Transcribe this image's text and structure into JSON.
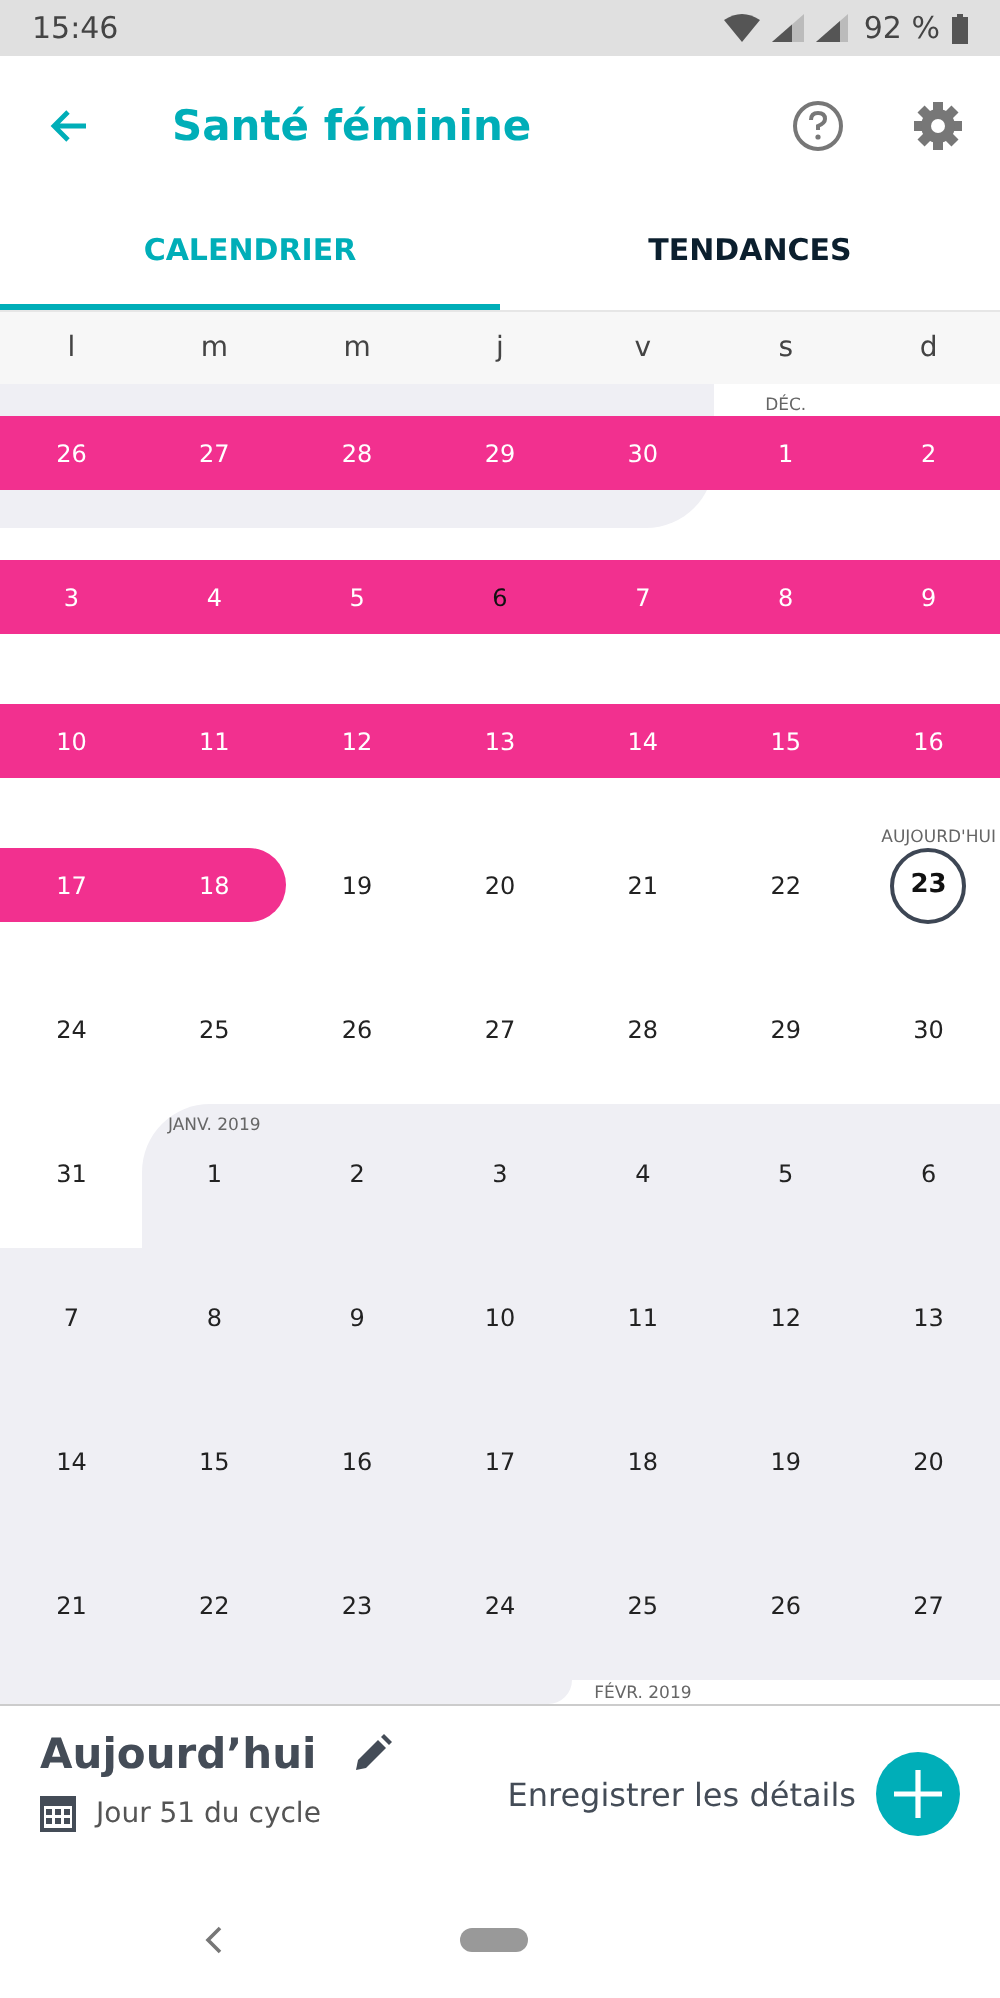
{
  "status_bar": {
    "time": "15:46",
    "battery": "92 %"
  },
  "app_bar": {
    "title": "Santé féminine"
  },
  "tabs": [
    {
      "label": "CALENDRIER",
      "selected": true
    },
    {
      "label": "TENDANCES",
      "selected": false
    }
  ],
  "weekdays": [
    "l",
    "m",
    "m",
    "j",
    "v",
    "s",
    "d"
  ],
  "weeks": [
    {
      "days": [
        {
          "number": "26",
          "period": true,
          "shaded": true,
          "selected": false,
          "today": false
        },
        {
          "number": "27",
          "period": true,
          "shaded": true,
          "selected": false,
          "today": false
        },
        {
          "number": "28",
          "period": true,
          "shaded": true,
          "selected": false,
          "today": false
        },
        {
          "number": "29",
          "period": true,
          "shaded": true,
          "selected": false,
          "today": false
        },
        {
          "number": "30",
          "period": true,
          "shaded": true,
          "selected": false,
          "today": false
        },
        {
          "number": "1",
          "period": true,
          "shaded": false,
          "selected": false,
          "today": false,
          "label": "DÉC."
        },
        {
          "number": "2",
          "period": true,
          "shaded": false,
          "selected": false,
          "today": false
        }
      ]
    },
    {
      "days": [
        {
          "number": "3",
          "period": true,
          "shaded": false,
          "selected": false,
          "today": false
        },
        {
          "number": "4",
          "period": true,
          "shaded": false,
          "selected": false,
          "today": false
        },
        {
          "number": "5",
          "period": true,
          "shaded": false,
          "selected": false,
          "today": false
        },
        {
          "number": "6",
          "period": true,
          "shaded": false,
          "selected": true,
          "today": false
        },
        {
          "number": "7",
          "period": true,
          "shaded": false,
          "selected": false,
          "today": false
        },
        {
          "number": "8",
          "period": true,
          "shaded": false,
          "selected": false,
          "today": false
        },
        {
          "number": "9",
          "period": true,
          "shaded": false,
          "selected": false,
          "today": false
        }
      ]
    },
    {
      "days": [
        {
          "number": "10",
          "period": true,
          "shaded": false,
          "selected": false,
          "today": false
        },
        {
          "number": "11",
          "period": true,
          "shaded": false,
          "selected": false,
          "today": false
        },
        {
          "number": "12",
          "period": true,
          "shaded": false,
          "selected": false,
          "today": false
        },
        {
          "number": "13",
          "period": true,
          "shaded": false,
          "selected": false,
          "today": false
        },
        {
          "number": "14",
          "period": true,
          "shaded": false,
          "selected": false,
          "today": false
        },
        {
          "number": "15",
          "period": true,
          "shaded": false,
          "selected": false,
          "today": false
        },
        {
          "number": "16",
          "period": true,
          "shaded": false,
          "selected": false,
          "today": false
        }
      ]
    },
    {
      "days": [
        {
          "number": "17",
          "period": true,
          "shaded": false,
          "selected": false,
          "today": false
        },
        {
          "number": "18",
          "period": true,
          "shaded": false,
          "selected": false,
          "today": false
        },
        {
          "number": "19",
          "period": false,
          "shaded": false,
          "selected": false,
          "today": false
        },
        {
          "number": "20",
          "period": false,
          "shaded": false,
          "selected": false,
          "today": false
        },
        {
          "number": "21",
          "period": false,
          "shaded": false,
          "selected": false,
          "today": false
        },
        {
          "number": "22",
          "period": false,
          "shaded": false,
          "selected": false,
          "today": false
        },
        {
          "number": "23",
          "period": false,
          "shaded": false,
          "selected": false,
          "today": true,
          "label": "AUJOURD'HUI"
        }
      ]
    },
    {
      "days": [
        {
          "number": "24",
          "period": false,
          "shaded": false,
          "selected": false,
          "today": false
        },
        {
          "number": "25",
          "period": false,
          "shaded": false,
          "selected": false,
          "today": false
        },
        {
          "number": "26",
          "period": false,
          "shaded": false,
          "selected": false,
          "today": false
        },
        {
          "number": "27",
          "period": false,
          "shaded": false,
          "selected": false,
          "today": false
        },
        {
          "number": "28",
          "period": false,
          "shaded": false,
          "selected": false,
          "today": false
        },
        {
          "number": "29",
          "period": false,
          "shaded": false,
          "selected": false,
          "today": false
        },
        {
          "number": "30",
          "period": false,
          "shaded": false,
          "selected": false,
          "today": false
        }
      ]
    },
    {
      "days": [
        {
          "number": "31",
          "period": false,
          "shaded": false,
          "selected": false,
          "today": false
        },
        {
          "number": "1",
          "period": false,
          "shaded": true,
          "selected": false,
          "today": false,
          "label": "JANV. 2019"
        },
        {
          "number": "2",
          "period": false,
          "shaded": true,
          "selected": false,
          "today": false
        },
        {
          "number": "3",
          "period": false,
          "shaded": true,
          "selected": false,
          "today": false
        },
        {
          "number": "4",
          "period": false,
          "shaded": true,
          "selected": false,
          "today": false
        },
        {
          "number": "5",
          "period": false,
          "shaded": true,
          "selected": false,
          "today": false
        },
        {
          "number": "6",
          "period": false,
          "shaded": true,
          "selected": false,
          "today": false
        }
      ]
    },
    {
      "days": [
        {
          "number": "7",
          "period": false,
          "shaded": true,
          "selected": false,
          "today": false
        },
        {
          "number": "8",
          "period": false,
          "shaded": true,
          "selected": false,
          "today": false
        },
        {
          "number": "9",
          "period": false,
          "shaded": true,
          "selected": false,
          "today": false
        },
        {
          "number": "10",
          "period": false,
          "shaded": true,
          "selected": false,
          "today": false
        },
        {
          "number": "11",
          "period": false,
          "shaded": true,
          "selected": false,
          "today": false
        },
        {
          "number": "12",
          "period": false,
          "shaded": true,
          "selected": false,
          "today": false
        },
        {
          "number": "13",
          "period": false,
          "shaded": true,
          "selected": false,
          "today": false
        }
      ]
    },
    {
      "days": [
        {
          "number": "14",
          "period": false,
          "shaded": true,
          "selected": false,
          "today": false
        },
        {
          "number": "15",
          "period": false,
          "shaded": true,
          "selected": false,
          "today": false
        },
        {
          "number": "16",
          "period": false,
          "shaded": true,
          "selected": false,
          "today": false
        },
        {
          "number": "17",
          "period": false,
          "shaded": true,
          "selected": false,
          "today": false
        },
        {
          "number": "18",
          "period": false,
          "shaded": true,
          "selected": false,
          "today": false
        },
        {
          "number": "19",
          "period": false,
          "shaded": true,
          "selected": false,
          "today": false
        },
        {
          "number": "20",
          "period": false,
          "shaded": true,
          "selected": false,
          "today": false
        }
      ]
    },
    {
      "days": [
        {
          "number": "21",
          "period": false,
          "shaded": true,
          "selected": false,
          "today": false
        },
        {
          "number": "22",
          "period": false,
          "shaded": true,
          "selected": false,
          "today": false
        },
        {
          "number": "23",
          "period": false,
          "shaded": true,
          "selected": false,
          "today": false
        },
        {
          "number": "24",
          "period": false,
          "shaded": true,
          "selected": false,
          "today": false
        },
        {
          "number": "25",
          "period": false,
          "shaded": true,
          "selected": false,
          "today": false
        },
        {
          "number": "26",
          "period": false,
          "shaded": true,
          "selected": false,
          "today": false
        },
        {
          "number": "27",
          "period": false,
          "shaded": true,
          "selected": false,
          "today": false
        }
      ]
    },
    {
      "days": [
        {
          "shaded": true
        },
        {
          "shaded": true
        },
        {
          "shaded": true
        },
        {
          "shaded": true
        },
        {
          "shaded": false,
          "label": "FÉVR. 2019"
        }
      ]
    }
  ],
  "summary": {
    "title": "Aujourd’hui",
    "cycle_day": "Jour 51 du cycle",
    "action": "Enregistrer les détails"
  }
}
